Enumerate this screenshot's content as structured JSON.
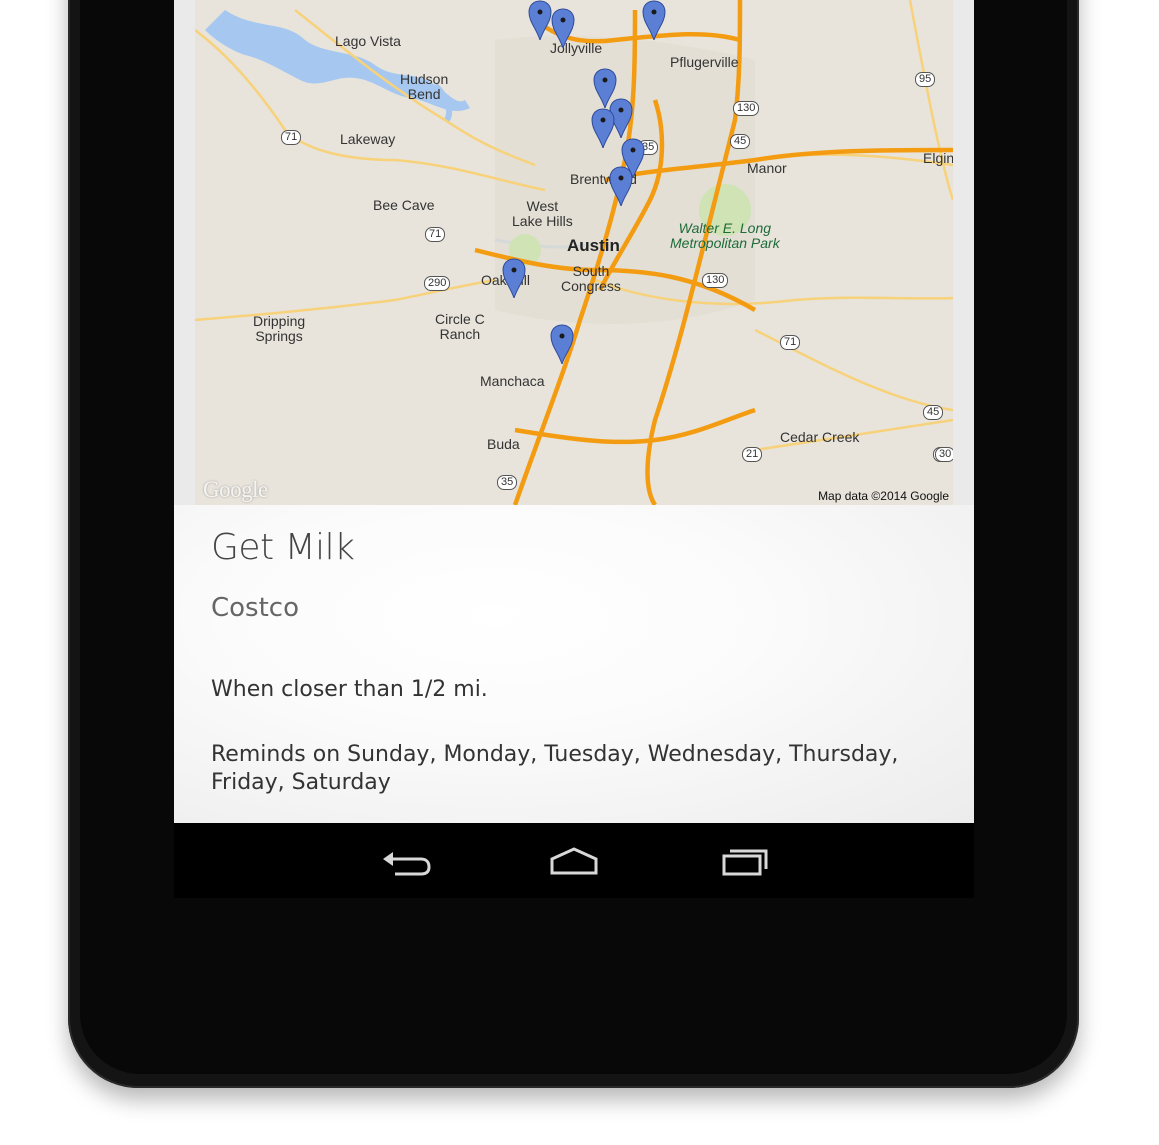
{
  "map": {
    "attribution": "Map data ©2014 Google",
    "logo": "Google",
    "places": [
      "Lago Vista",
      "Jollyville",
      "Pflugerville",
      "Hudson\nBend",
      "Lakeway",
      "Manor",
      "Elgin",
      "Brentwood",
      "West\nLake Hills",
      "Bee Cave",
      "Walter E. Long\nMetropolitan Park",
      "Austin",
      "South\nCongress",
      "Oak Hill",
      "Dripping\nSprings",
      "Circle C\nRanch",
      "Manchaca",
      "Buda",
      "Cedar Creek"
    ],
    "highway_shields": [
      "95",
      "130",
      "45",
      "71",
      "35",
      "71",
      "290",
      "130",
      "71",
      "45",
      "21",
      "21",
      "35",
      "30"
    ],
    "marker_color": "#5b7fd4",
    "road_color": "#f5a623"
  },
  "reminder": {
    "title": "Get Milk",
    "location": "Costco",
    "condition": "When closer than 1/2 mi.",
    "days": "Reminds on  Sunday, Monday, Tuesday, Wednesday, Thursday, Friday, Saturday"
  },
  "navbar": {
    "back_icon": "back-arrow-icon",
    "home_icon": "home-icon",
    "recents_icon": "recent-apps-icon"
  }
}
